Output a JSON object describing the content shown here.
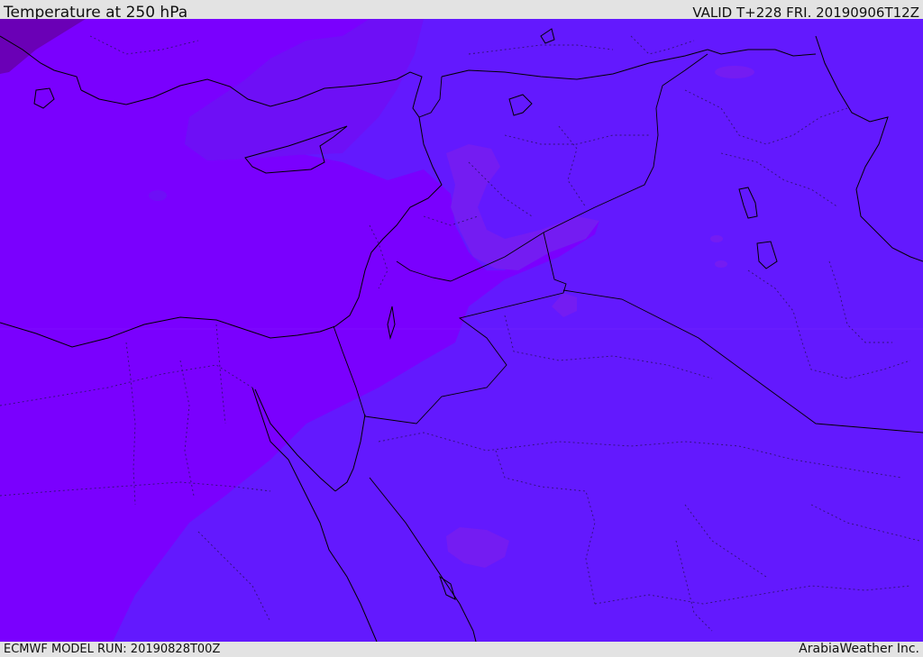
{
  "header": {
    "title": "Temperature at 250 hPa",
    "valid": "VALID T+228 FRI. 20190906T12Z"
  },
  "footer": {
    "model_run": "ECMWF MODEL RUN: 20190828T00Z",
    "credit": "ArabiaWeather Inc."
  },
  "map": {
    "field": "temperature",
    "level": "250 hPa",
    "colors": {
      "warm_band": "#7a00ff",
      "mid_band": "#6f0cf6",
      "cool_band": "#6218ff",
      "cold_patch": "#7a1ff0",
      "dark_corner": "#6a00b8",
      "coastline": "#000000",
      "borders_dotted": "#2a1166"
    }
  }
}
